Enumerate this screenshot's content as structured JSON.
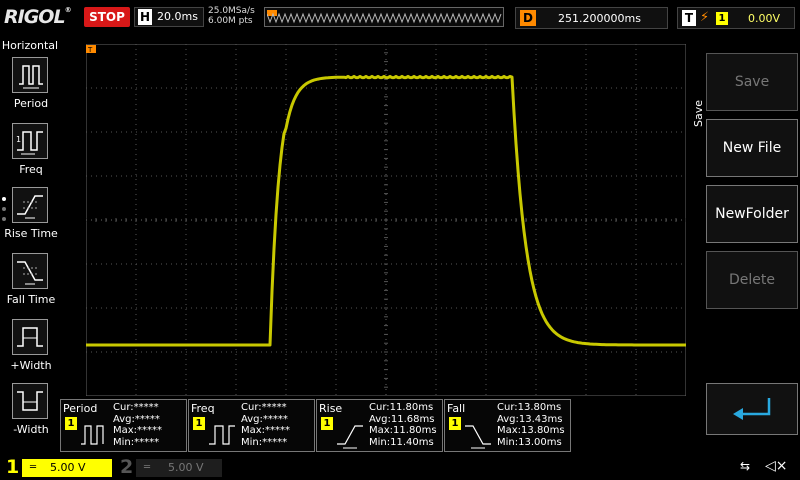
{
  "topbar": {
    "logo": "RIGOL",
    "run_state": "STOP",
    "timebase_label": "H",
    "timebase_value": "20.0ms",
    "sample_rate": "25.0MSa/s",
    "memory_depth": "6.00M pts",
    "delay_label": "D",
    "delay_value": "251.200000ms",
    "trigger_label": "T",
    "trigger_channel": "1",
    "trigger_level": "0.00V"
  },
  "left_panel": {
    "title": "Horizontal",
    "items": [
      {
        "label": "Period",
        "icon": "period-icon"
      },
      {
        "label": "Freq",
        "icon": "frequency-icon"
      },
      {
        "label": "Rise Time",
        "icon": "rise-time-icon"
      },
      {
        "label": "Fall Time",
        "icon": "fall-time-icon"
      },
      {
        "label": "+Width",
        "icon": "positive-width-icon"
      },
      {
        "label": "-Width",
        "icon": "negative-width-icon"
      }
    ]
  },
  "right_panel": {
    "title": "Save",
    "buttons": [
      {
        "label": "Save",
        "enabled": false
      },
      {
        "label": "New File",
        "enabled": true
      },
      {
        "label": "NewFolder",
        "enabled": true
      },
      {
        "label": "Delete",
        "enabled": false
      }
    ],
    "back_icon": "return-arrow-icon"
  },
  "measurements": [
    {
      "name": "Period",
      "channel": "1",
      "cur": "Cur:*****",
      "avg": "Avg:*****",
      "max": "Max:*****",
      "min": "Min:*****"
    },
    {
      "name": "Freq",
      "channel": "1",
      "cur": "Cur:*****",
      "avg": "Avg:*****",
      "max": "Max:*****",
      "min": "Min:*****"
    },
    {
      "name": "Rise",
      "channel": "1",
      "cur": "Cur:11.80ms",
      "avg": "Avg:11.68ms",
      "max": "Max:11.80ms",
      "min": "Min:11.40ms"
    },
    {
      "name": "Fall",
      "channel": "1",
      "cur": "Cur:13.80ms",
      "avg": "Avg:13.43ms",
      "max": "Max:13.80ms",
      "min": "Min:13.00ms"
    }
  ],
  "channels": {
    "ch1": {
      "number": "1",
      "coupling": "═",
      "scale": "5.00 V"
    },
    "ch2": {
      "number": "2",
      "coupling": "═",
      "scale": "5.00 V"
    }
  },
  "status": {
    "usb": "⇆",
    "sound": "◁×"
  },
  "colors": {
    "trace": "#c8c800",
    "grid": "#555555",
    "accent": "#ff8a00",
    "ch1": "#ffff00",
    "stop": "#d81818"
  }
}
